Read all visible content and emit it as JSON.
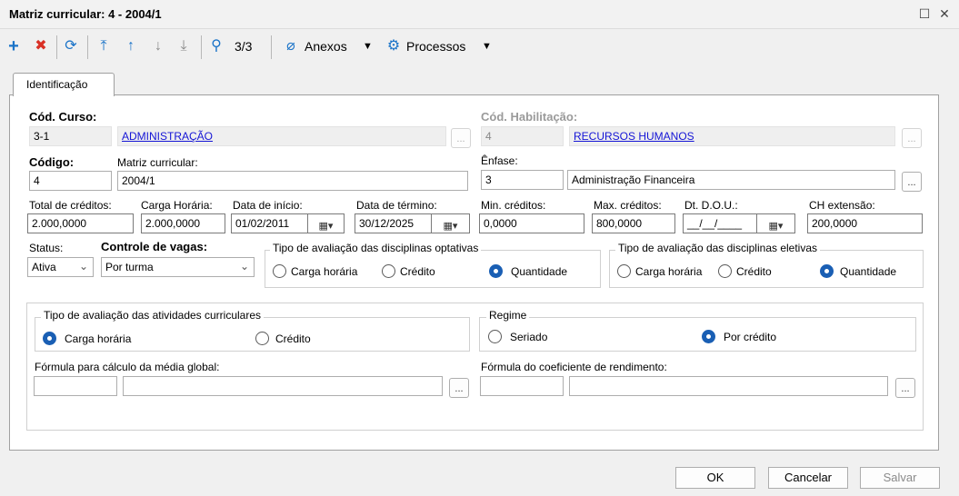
{
  "window": {
    "title": "Matriz curricular: 4 - 2004/1"
  },
  "toolbar": {
    "counter": "3/3",
    "attachments_label": "Anexos",
    "processes_label": "Processos"
  },
  "tabs": [
    {
      "label": "Identificação"
    }
  ],
  "form": {
    "cod_curso_label": "Cód. Curso:",
    "cod_curso_value": "3-1",
    "curso_name": "ADMINISTRAÇÃO",
    "cod_habilitacao_label": "Cód. Habilitação:",
    "cod_habilitacao_value": "4",
    "habilitacao_name": "RECURSOS HUMANOS",
    "codigo_label": "Código:",
    "codigo_value": "4",
    "matriz_label": "Matriz curricular:",
    "matriz_value": "2004/1",
    "enfase_label": "Ênfase:",
    "enfase_code": "3",
    "enfase_name": "Administração Financeira",
    "total_creditos_label": "Total de créditos:",
    "total_creditos_value": "2.000,0000",
    "carga_horaria_label": "Carga Horária:",
    "carga_horaria_value": "2.000,0000",
    "data_inicio_label": "Data de início:",
    "data_inicio_value": "01/02/2011",
    "data_termino_label": "Data de término:",
    "data_termino_value": "30/12/2025",
    "min_creditos_label": "Min. créditos:",
    "min_creditos_value": "0,0000",
    "max_creditos_label": "Max. créditos:",
    "max_creditos_value": "800,0000",
    "dt_dou_label": "Dt. D.O.U.:",
    "dt_dou_value": "__/__/____",
    "ch_extensao_label": "CH extensão:",
    "ch_extensao_value": "200,0000",
    "status_label": "Status:",
    "status_value": "Ativa",
    "controle_label": "Controle de vagas:",
    "controle_value": "Por turma",
    "formula_media_label": "Fórmula para cálculo da média global:",
    "formula_coef_label": "Fórmula do coeficiente de rendimento:"
  },
  "groups": {
    "optativas": {
      "title": "Tipo de avaliação das disciplinas optativas",
      "options": [
        "Carga horária",
        "Crédito",
        "Quantidade"
      ],
      "selected": "Quantidade"
    },
    "eletivas": {
      "title": "Tipo de avaliação das disciplinas eletivas",
      "options": [
        "Carga horária",
        "Crédito",
        "Quantidade"
      ],
      "selected": "Quantidade"
    },
    "atividades": {
      "title": "Tipo de avaliação das atividades curriculares",
      "options": [
        "Carga horária",
        "Crédito"
      ],
      "selected": "Carga horária"
    },
    "regime": {
      "title": "Regime",
      "options": [
        "Seriado",
        "Por crédito"
      ],
      "selected": "Por crédito"
    }
  },
  "buttons": {
    "ok": "OK",
    "cancel": "Cancelar",
    "save": "Salvar",
    "dots": "..."
  },
  "colors": {
    "accent": "#1a5fb4",
    "link": "#1515d6",
    "add": "#1a73c8",
    "delete": "#d93025"
  }
}
